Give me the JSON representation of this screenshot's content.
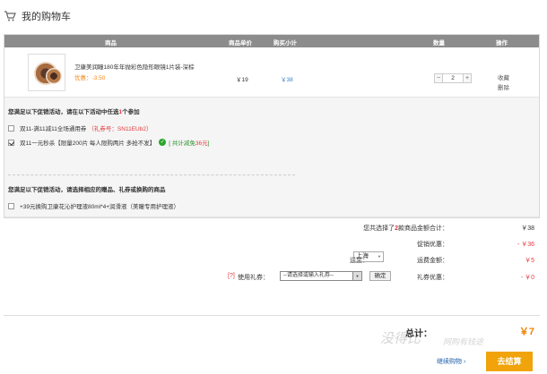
{
  "header": {
    "title": "我的购物车"
  },
  "table": {
    "headers": [
      "商品",
      "商品单价",
      "购买小计",
      "数量",
      "操作"
    ]
  },
  "item": {
    "name": "卫康美润瞳180年年抛彩色隐形眼镜1片装-深棕",
    "promo": "优惠：-3.50",
    "price": "￥19",
    "subtotal": "￥38",
    "qty_minus": "−",
    "qty": "2",
    "qty_plus": "+",
    "fav": "收藏",
    "delete": "删除"
  },
  "promo": {
    "title1_a": "您满足以下促销活动，请在以下活动中任选",
    "title1_b": "1",
    "title1_c": "个参加",
    "opt1_text": "双11-满11减11全场通用券",
    "opt1_code": "（礼券号：SN11EUb2）",
    "opt2_text": "双11一元秒杀【限量200片 每人限购两片 多抢不发】",
    "opt2_save_a": "[ 共计减免",
    "opt2_save_num": "36元",
    "opt2_save_b": "]",
    "title2": "您满足以下促销活动，请选择相应的赠品、礼券或换购的商品",
    "opt3_text": "+39元换购卫康花沁护理液80ml*4+润滑液（美瞳专用护理液）"
  },
  "summary": {
    "selected_a": "您共选择了",
    "selected_num": "2",
    "selected_b": "款商品金额合计：",
    "selected_val": "￥38",
    "discount_label": "促销优惠：",
    "discount_val": "- ￥36",
    "region_label": "送至：",
    "region_value": "上海",
    "shipping_label": "运费金额：",
    "shipping_val": "￥5",
    "coupon_help": "[?]",
    "coupon_label": "使用礼券：",
    "coupon_placeholder": "--请选择或输入礼券--",
    "confirm": "确定",
    "coupon_discount_label": "礼券优惠：",
    "coupon_discount_val": "- ￥0",
    "total_label": "总计：",
    "total_val": "￥7",
    "continue": "继续购物 ›",
    "checkout": "去结算"
  },
  "watermark": {
    "text1": "没得比",
    "text2": "网购有钱途"
  },
  "icons": {
    "cart": "cart-icon",
    "check": "check-circle-icon",
    "dropdown": "chevron-down-icon"
  },
  "colors": {
    "accent": "#e4393c",
    "checkout": "#f0a30a",
    "header": "#8c8c8c",
    "link": "#1e5fa8"
  }
}
